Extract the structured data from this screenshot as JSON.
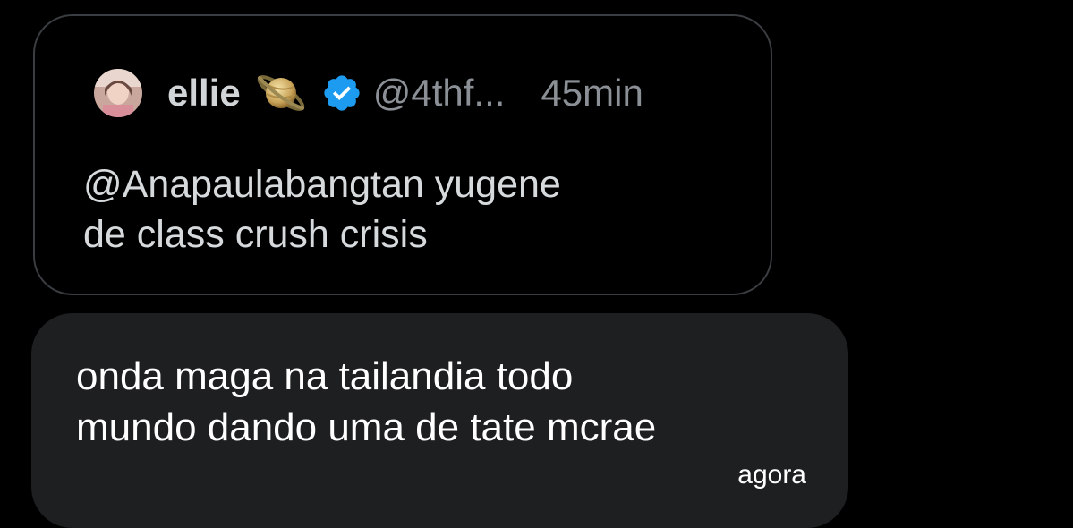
{
  "quoted_tweet": {
    "author_name": "ellie",
    "name_emoji_icon": "ringed-planet-icon",
    "verified_icon": "verified-badge-icon",
    "handle": "@4thf...",
    "time": "45min",
    "text_lines": [
      "@Anapaulabangtan yugene",
      "de class crush crisis"
    ]
  },
  "message": {
    "text_lines": [
      "onda maga na tailandia todo",
      "mundo dando uma de tate mcrae"
    ],
    "time": "agora"
  },
  "colors": {
    "background": "#000000",
    "card_border": "#3a3d41",
    "bubble_background": "#1d1f21",
    "verified": "#1d9bf0",
    "muted_text": "#8b9096"
  }
}
